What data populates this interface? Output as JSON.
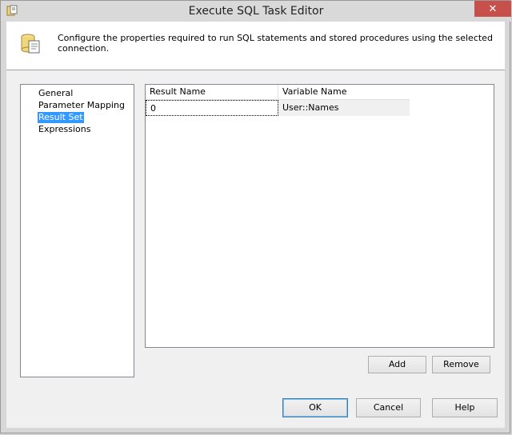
{
  "window": {
    "title": "Execute SQL Task Editor",
    "close_glyph": "✕",
    "app_icon": "sql-task-icon"
  },
  "header": {
    "icon": "database-script-icon",
    "text": "Configure the properties required to run SQL statements and stored procedures using the selected connection."
  },
  "nav": {
    "items": [
      {
        "label": "General",
        "selected": false
      },
      {
        "label": "Parameter Mapping",
        "selected": false
      },
      {
        "label": "Result Set",
        "selected": true
      },
      {
        "label": "Expressions",
        "selected": false
      }
    ]
  },
  "result_grid": {
    "columns": [
      "Result Name",
      "Variable Name"
    ],
    "rows": [
      {
        "result_name": "0",
        "variable_name": "User::Names"
      }
    ]
  },
  "buttons": {
    "add": "Add",
    "remove": "Remove",
    "ok": "OK",
    "cancel": "Cancel",
    "help": "Help"
  },
  "colors": {
    "selection": "#3399ff",
    "close_button": "#c7504b"
  }
}
